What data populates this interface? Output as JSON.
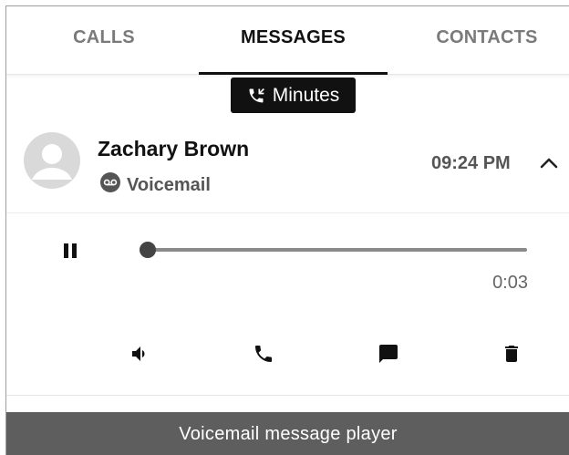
{
  "tabs": [
    {
      "label": "CALLS",
      "active": false
    },
    {
      "label": "MESSAGES",
      "active": true
    },
    {
      "label": "CONTACTS",
      "active": false
    }
  ],
  "minutes_badge": {
    "icon": "phone-callback-icon",
    "label": "Minutes"
  },
  "message": {
    "contact_name": "Zachary Brown",
    "type_icon": "voicemail-icon",
    "type_label": "Voicemail",
    "time": "09:24 PM",
    "expanded": true,
    "collapse_icon": "chevron-up-icon"
  },
  "player": {
    "state_icon": "pause-icon",
    "progress_fraction": 0.02,
    "elapsed": "0:03"
  },
  "actions": [
    {
      "icon": "volume-icon"
    },
    {
      "icon": "phone-icon"
    },
    {
      "icon": "message-icon"
    },
    {
      "icon": "trash-icon"
    }
  ],
  "caption": "Voicemail message player",
  "colors": {
    "active_tab": "#111111",
    "inactive_tab": "#7a7a7a",
    "badge_bg": "#111111",
    "caption_bg": "#5e5e5e"
  }
}
